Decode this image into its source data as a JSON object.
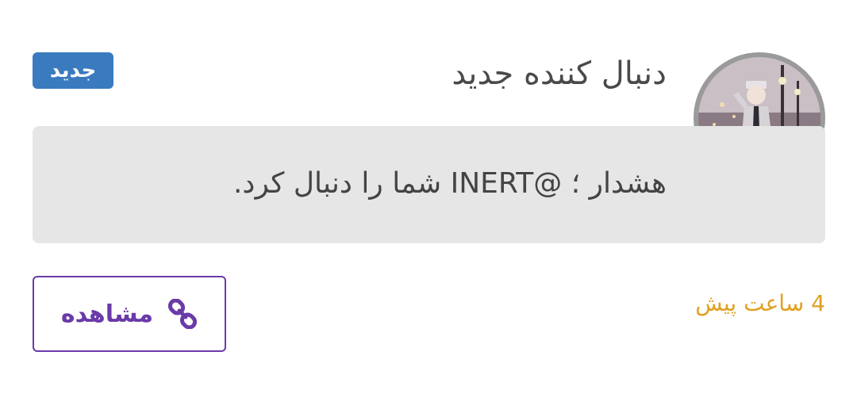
{
  "notification": {
    "title": "دنبال کننده جدید",
    "badge": "جدید",
    "message": "هشدار ؛ @INERT شما را دنبال کرد.",
    "time": "4 ساعت پیش",
    "view_label": "مشاهده"
  },
  "icons": {
    "view": "link-icon"
  },
  "colors": {
    "badge_bg": "#3a7bbf",
    "accent": "#6a3aa8",
    "time": "#e0a020",
    "message_bg": "#e6e6e6"
  }
}
